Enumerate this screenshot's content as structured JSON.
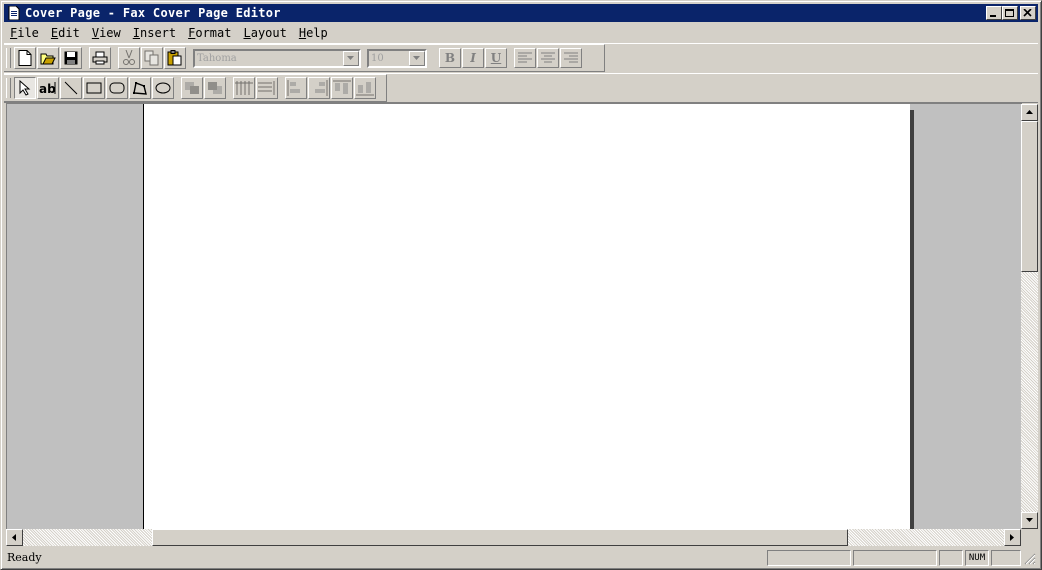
{
  "window": {
    "title": "Cover Page - Fax Cover Page Editor"
  },
  "menu": {
    "items": [
      {
        "key": "F",
        "rest": "ile"
      },
      {
        "key": "E",
        "rest": "dit"
      },
      {
        "key": "V",
        "rest": "iew"
      },
      {
        "key": "I",
        "rest": "nsert"
      },
      {
        "key": "F",
        "rest": "ormat"
      },
      {
        "key": "L",
        "rest": "ayout"
      },
      {
        "key": "H",
        "rest": "elp"
      }
    ]
  },
  "format_toolbar": {
    "font_name": "Tahoma",
    "font_size": "10",
    "bold_label": "B",
    "italic_label": "I",
    "underline_label": "U"
  },
  "status": {
    "text": "Ready",
    "num_indicator": "NUM"
  },
  "colors": {
    "titlebar": "#0a246a",
    "face": "#d4d0c8",
    "workspace": "#c0c0c0",
    "page": "#ffffff"
  }
}
